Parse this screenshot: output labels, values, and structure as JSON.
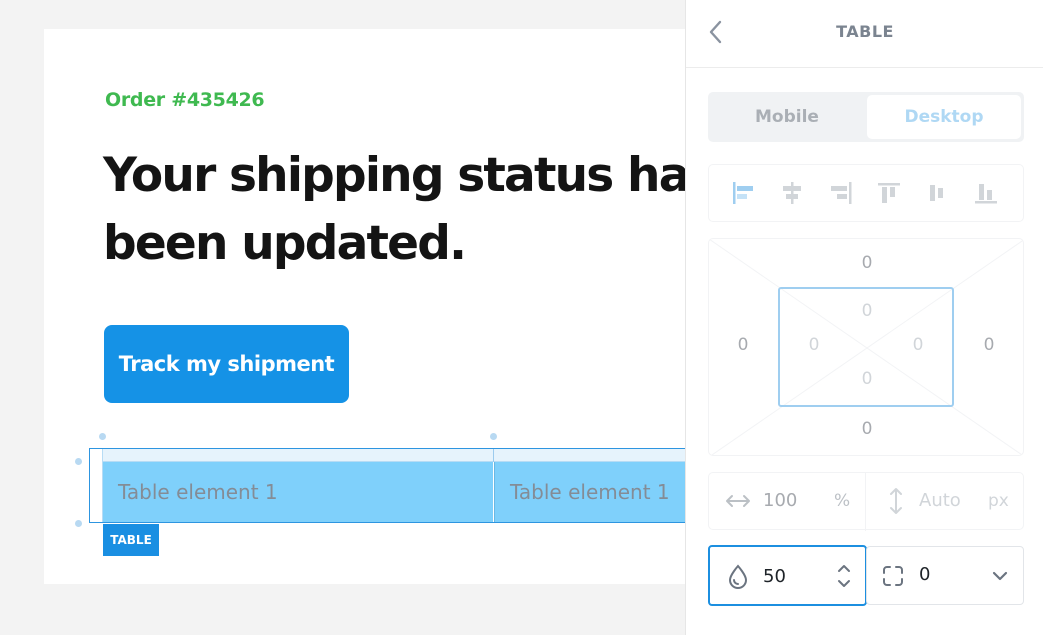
{
  "email": {
    "order_label": "Order #435426",
    "headline": "Your shipping status has been updated.",
    "button_label": "Track my shipment",
    "table_cells": [
      "Table element 1",
      "Table element 1"
    ],
    "table_badge": "TABLE"
  },
  "panel": {
    "title": "TABLE",
    "tabs": {
      "mobile": "Mobile",
      "desktop": "Desktop",
      "active": "Desktop"
    },
    "alignment_icons": [
      "align-left-icon",
      "align-center-h-icon",
      "align-right-icon",
      "align-top-icon",
      "align-middle-icon",
      "align-bottom-icon"
    ],
    "margin": {
      "top": "0",
      "right": "0",
      "bottom": "0",
      "left": "0"
    },
    "padding": {
      "top": "0",
      "right": "0",
      "bottom": "0",
      "left": "0"
    },
    "width": {
      "value": "100",
      "unit": "%"
    },
    "height": {
      "value": "Auto",
      "unit": "px"
    },
    "opacity": "50",
    "border_radius": "0"
  },
  "colors": {
    "order_green": "#3fb950",
    "button_blue": "#1592e6",
    "selection_blue": "#2d95e0",
    "cell_fill": "#7fd0fb"
  }
}
